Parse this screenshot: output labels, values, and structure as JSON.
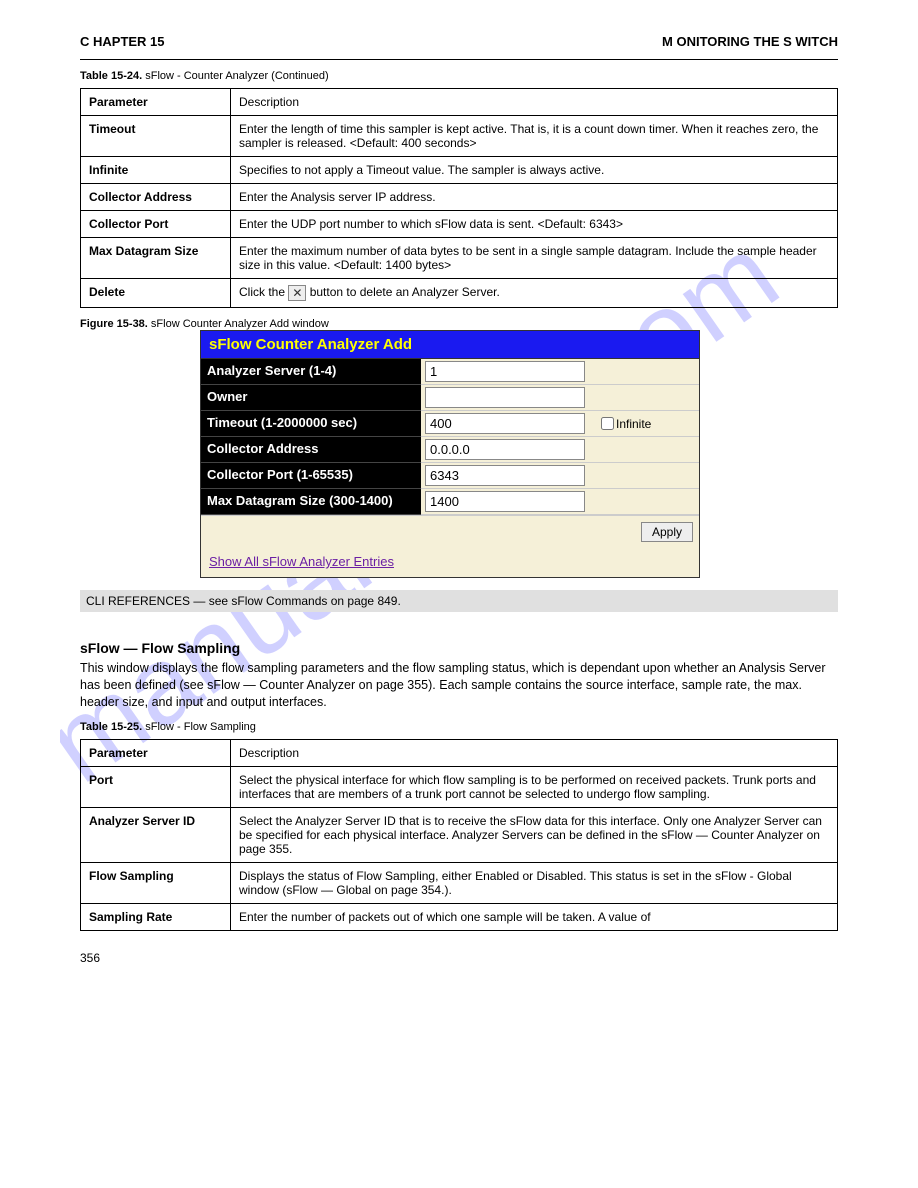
{
  "header": {
    "title": "M ONITORING THE S WITCH",
    "chapter": "C HAPTER 15"
  },
  "table1": {
    "caption_prefix": "Table 15-24.",
    "caption": "sFlow - Counter Analyzer  (Continued)",
    "rows": [
      {
        "label": "Parameter",
        "desc": "Description"
      },
      {
        "label": "Timeout",
        "desc": "Enter the length of time this sampler is kept active. That is, it is a count down timer. When it reaches zero, the sampler is released. <Default: 400 seconds>"
      },
      {
        "label": "Infinite",
        "desc": "Specifies to not apply a Timeout value. The sampler is always active."
      },
      {
        "label": "Collector Address",
        "desc": "Enter the Analysis server IP address."
      },
      {
        "label": "Collector Port",
        "desc": "Enter the UDP port number to which sFlow data is sent. <Default: 6343>"
      },
      {
        "label": "Max Datagram Size",
        "desc": "Enter the maximum number of data bytes to be sent in a single sample datagram. Include the sample header size in this value. <Default: 1400 bytes>"
      },
      {
        "label": "Delete",
        "desc_before": "Click the ",
        "desc_after": " button to delete an Analyzer Server."
      }
    ]
  },
  "figure": {
    "label": "Figure 15-38.",
    "caption": "sFlow Counter Analyzer Add window"
  },
  "analyzer": {
    "title": "sFlow Counter Analyzer Add",
    "rows": {
      "server": {
        "label": "Analyzer Server (1-4)",
        "value": "1"
      },
      "owner": {
        "label": "Owner",
        "value": ""
      },
      "timeout": {
        "label": "Timeout (1-2000000 sec)",
        "value": "400",
        "infinite": "Infinite"
      },
      "address": {
        "label": "Collector Address",
        "value": "0.0.0.0"
      },
      "port": {
        "label": "Collector Port (1-65535)",
        "value": "6343"
      },
      "datagram": {
        "label": "Max Datagram Size (300-1400)",
        "value": "1400"
      }
    },
    "apply": "Apply",
    "link": "Show All sFlow Analyzer Entries"
  },
  "cli": {
    "text": "CLI REFERENCES — see sFlow Commands on page 849."
  },
  "section2": {
    "heading": "sFlow — Flow Sampling",
    "para": "This window displays the flow sampling parameters and the flow sampling status, which is dependant upon whether an Analysis Server has been defined (see sFlow — Counter Analyzer on page 355). Each sample contains the source interface, sample rate, the max. header size, and input and output interfaces.",
    "caption_prefix": "Table 15-25.",
    "caption": "sFlow - Flow Sampling",
    "rows": [
      {
        "label": "Parameter",
        "desc": "Description"
      },
      {
        "label": "Port",
        "desc": "Select the physical interface for which flow sampling is to be performed on received packets. Trunk ports and interfaces that are members of a trunk port cannot be selected to undergo flow sampling."
      },
      {
        "label": "Analyzer Server ID",
        "desc": "Select the Analyzer Server ID that is to receive the sFlow data for this interface. Only one Analyzer Server can be specified for each physical interface. Analyzer Servers can be defined in the sFlow — Counter Analyzer on page 355."
      },
      {
        "label": "Flow Sampling",
        "desc": "Displays the status of Flow Sampling, either Enabled or Disabled. This status is set in the sFlow - Global window (sFlow — Global on page 354.)."
      },
      {
        "label": "Sampling Rate",
        "desc": "Enter the number of packets out of which one sample will be taken. A value of"
      }
    ]
  },
  "page_num": "356"
}
